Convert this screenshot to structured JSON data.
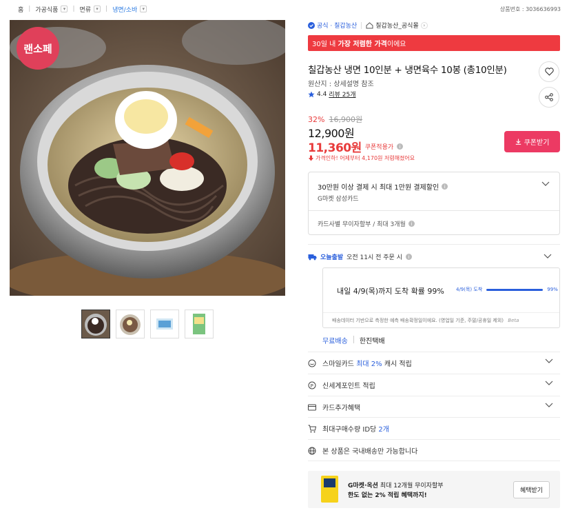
{
  "breadcrumb": {
    "home": "홈",
    "items": [
      "가공식품",
      "면류",
      "냉면/소바"
    ]
  },
  "product_id": "상품번호 : 3036636993",
  "image": {
    "badge_text": "랜소페"
  },
  "seller": {
    "official": "공식 · 칠갑농산",
    "store": "칠갑농산_공식몰"
  },
  "banner": {
    "prefix": "30일 내",
    "highlight": "가장 저렴한 가격",
    "suffix": "이에요"
  },
  "product": {
    "title": "칠갑농산 냉면 10인분 + 냉면육수 10봉 (총10인분)",
    "origin": "원산지 : 상세설명 참조",
    "rating": "4.4",
    "reviews": "리뷰 25개"
  },
  "price": {
    "discount_pct": "32%",
    "original": "16,900원",
    "sale": "12,900원",
    "coupon_price": "11,360원",
    "coupon_label": "쿠폰적용가",
    "note": "가격인하! 어제부터 4,170원 저렴해졌어요",
    "coupon_button": "쿠폰받기"
  },
  "card_benefit": {
    "title": "30만원 이상 결제 시 최대 1만원 결제할인",
    "cards": "G마켓 삼성카드",
    "installment": "카드사별 무이자할부 / 최대 3개월"
  },
  "delivery": {
    "badge": "오늘출발",
    "condition": "오전 11시 전 주문 시",
    "estimate": "내일 4/9(목)까지 도착 확률 99%",
    "bar_label": "4/9(목) 도착",
    "bar_pct": "99%",
    "bar_fraction": 0.99,
    "note": "배송데이터 기반으로 측정한 예측 배송확정일이에요. (영업일 기준, 주말/공휴일 제외)",
    "beta": "Beta",
    "shipping_free": "무료배송",
    "courier": "한진택배"
  },
  "rows": {
    "smile": {
      "prefix": "스마일카드",
      "highlight": "최대 2%",
      "suffix": "캐시 적립"
    },
    "shinsegae": "신세계포인트 적립",
    "card_extra": "카드추가혜택",
    "maxbuy": {
      "prefix": "최대구매수량 ID당",
      "highlight": "2개"
    },
    "domestic": "본 상품은 국내배송만 가능합니다"
  },
  "promo": {
    "brand": "G마켓·옥션",
    "line1_rest": "최대 12개월 무이자할부",
    "line2": "한도 없는 2% 적립 혜택까지!",
    "button": "혜택받기"
  },
  "colors": {
    "accent_red": "#e83b3b",
    "banner_red": "#ee3a40",
    "coupon_pink": "#ec3a63",
    "link_blue": "#2a5fdc"
  }
}
